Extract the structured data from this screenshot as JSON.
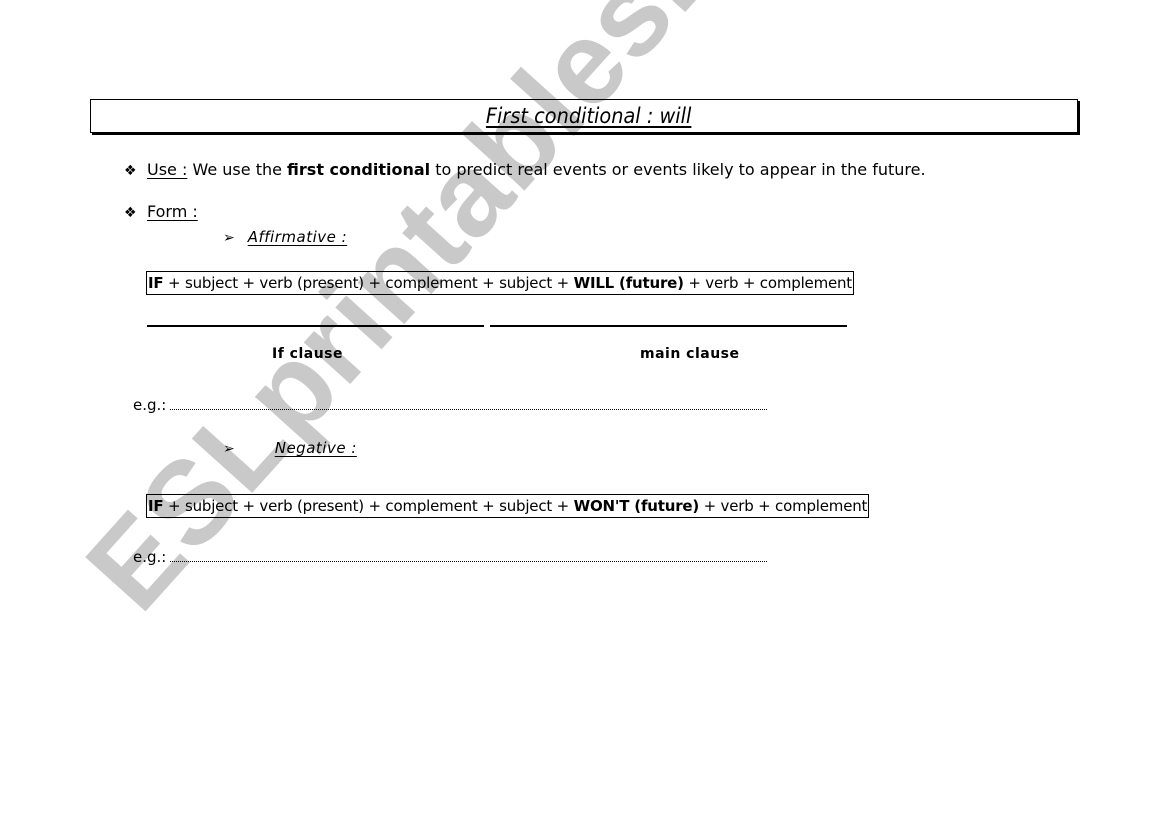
{
  "watermark": "ESLprintables.com",
  "title": "First conditional : will",
  "use": {
    "bullet": "❖",
    "label": "Use :",
    "text_before": "We use the",
    "bold": "first conditional",
    "text_after": "to predict real events or events likely  to appear in the future."
  },
  "form": {
    "bullet": "❖",
    "label": "Form :"
  },
  "affirmative": {
    "arrow": "➢",
    "heading": "Affirmative :",
    "formula": {
      "if_kw": "IF",
      "part1": "+ subject + verb (present) + complement + subject +",
      "aux_kw": "WILL (future)",
      "part2": "+ verb + complement"
    },
    "if_clause_label": "If clause",
    "main_clause_label": "main clause",
    "example_label": "e.g.:"
  },
  "negative": {
    "arrow": "➢",
    "heading": "Negative :",
    "formula": {
      "if_kw": "IF",
      "part1": "+ subject + verb (present) + complement + subject +",
      "aux_kw": "WON'T (future)",
      "part2": "+ verb + complement"
    },
    "example_label": "e.g.:"
  }
}
